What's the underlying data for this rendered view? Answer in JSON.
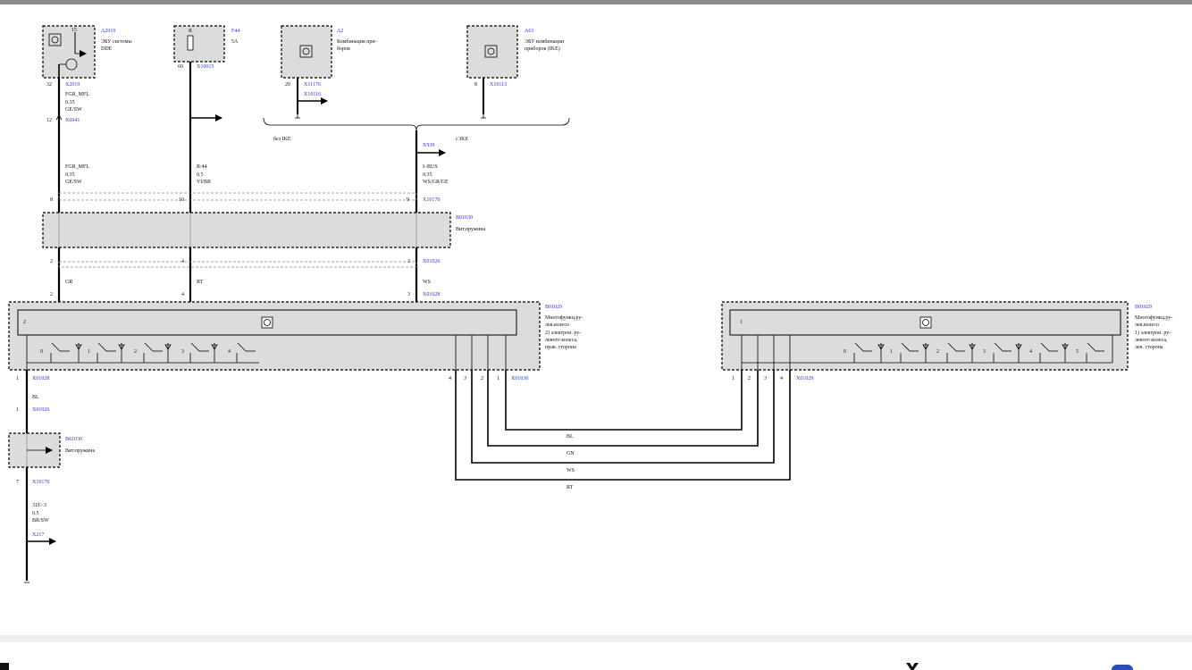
{
  "components": {
    "a2019": {
      "id": "A2019",
      "desc1": "ЭБУ системы",
      "desc2": "DDE",
      "pin": "32",
      "conn": "X2019",
      "pin2": "12",
      "conn2": "X6041",
      "s15": "15"
    },
    "f44": {
      "id": "F44",
      "desc1": "5A",
      "pin": "60",
      "conn": "X10015",
      "r": "R"
    },
    "a2": {
      "id": "A2",
      "desc1": "Комбинация при-",
      "desc2": "боров",
      "pin": "20",
      "conn": "X11176",
      "conn2": "X10116"
    },
    "a63": {
      "id": "A63",
      "desc1": "ЭБУ комбинации",
      "desc2": "приборов (IKE)",
      "pin": "8",
      "conn": "X10113"
    },
    "b01030_top": {
      "id": "B01030",
      "desc": "Вит.пружина"
    },
    "b01029_right": {
      "id": "B01029",
      "desc1": "Многофункц.ру-",
      "desc2": "лев.колесо",
      "desc3": "2) электрон. ру-",
      "desc4": "левого колеса,",
      "desc5": "прав. сторона",
      "index": "2"
    },
    "b01029_left": {
      "id": "B01029",
      "desc1": "Многофункц.ру-",
      "desc2": "лев.колесо",
      "desc3": "1) электрон. ру-",
      "desc4": "левого колеса,",
      "desc5": "лев. сторона",
      "index": "1"
    },
    "b01030_bottom": {
      "id": "B01030",
      "desc": "Вит.пружина"
    }
  },
  "wires": {
    "w1_top": {
      "name": "FGR_MFL",
      "size": "0.35",
      "color": "GE/SW"
    },
    "w1_mid": {
      "name": "FGR_MFL",
      "size": "0.35",
      "color": "GE/SW"
    },
    "w2": {
      "name": "R:44",
      "size": "0.5",
      "color": "VI/BR"
    },
    "w3": {
      "name": "I–BUS",
      "size": "0.35",
      "color": "WS/GR/GE",
      "conn": "X939"
    },
    "bottom": {
      "name": "31E<3",
      "size": "0.5",
      "color": "BR/SW",
      "conn": "X217"
    },
    "gr": "GR",
    "rt": "RT",
    "ws": "WS",
    "bl": "BL"
  },
  "labels": {
    "bez_ike": "без IKE",
    "s_ike": "с IKE",
    "pin8": "8",
    "pin10": "10",
    "pin9": "9",
    "x10170": "X10170",
    "p2a": "2",
    "p4a": "4",
    "p3a": "3",
    "x01026": "X01026",
    "p2b": "2",
    "p4b": "4",
    "p3b": "3",
    "x01028": "X01028",
    "p1": "1",
    "x01028b": "X01028",
    "p1b": "1",
    "x01026b": "X01026",
    "p7": "7",
    "x10170b": "X10170",
    "rp4": "4",
    "rp3": "3",
    "rp2": "2",
    "rp1": "1",
    "x01030": "X01030",
    "lp1": "1",
    "lp2": "2",
    "lp3": "3",
    "lp4": "4",
    "x01029": "X01029",
    "loop_bl": "BL",
    "loop_gn": "GN",
    "loop_ws": "WS",
    "loop_rt": "RT",
    "sw0": "0",
    "sw1": "1",
    "sw2": "2",
    "sw3": "3",
    "sw4": "4",
    "sw5": "5"
  }
}
